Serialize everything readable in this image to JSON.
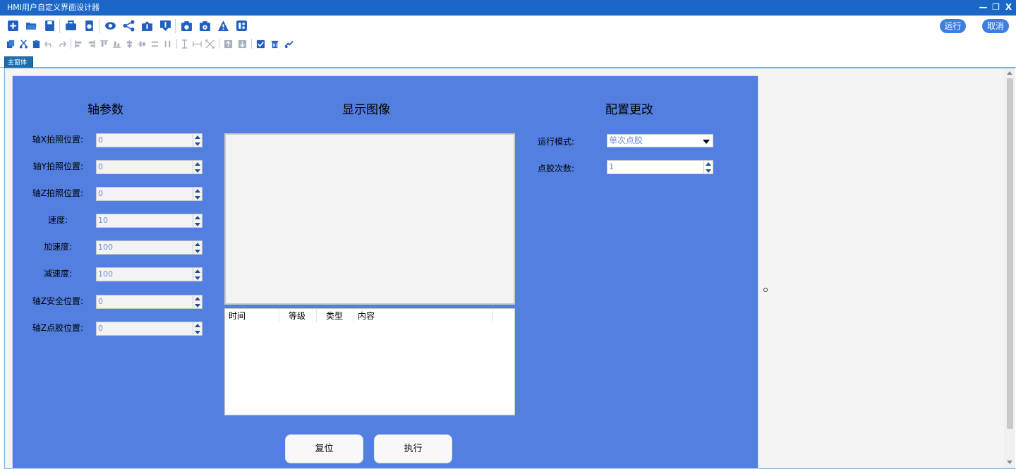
{
  "window": {
    "title": "HMI用户自定义界面设计器",
    "controls": [
      "—",
      "❐",
      "X"
    ]
  },
  "toolbar": {
    "primary_icons": [
      "new-icon",
      "open-folder-icon",
      "save-icon",
      "toolbox-icon",
      "export-icon",
      "preview-eye-icon",
      "share-icon",
      "upload-icon",
      "download-icon",
      "camera-icon",
      "camera-settings-icon",
      "warning-icon",
      "layout-icon"
    ],
    "edit_icons": [
      "copy-icon",
      "cut-icon",
      "paste-icon",
      "undo-icon",
      "redo-icon",
      "align-left-icon",
      "align-right-icon",
      "align-top-icon",
      "align-bottom-icon",
      "align-center-vertical-icon",
      "align-center-horizontal-icon",
      "distribute-horizontal-icon",
      "distribute-vertical-icon",
      "same-height-icon",
      "same-width-icon",
      "same-size-icon",
      "bring-front-icon",
      "send-back-icon",
      "select-all-icon",
      "delete-icon",
      "tool-icon"
    ],
    "run_label": "运行",
    "cancel_label": "取消"
  },
  "tabs": [
    {
      "label": "主窗体"
    }
  ],
  "form": {
    "axis_section_title": "轴参数",
    "image_section_title": "显示图像",
    "config_section_title": "配置更改",
    "axis_fields": [
      {
        "label": "轴X拍照位置:",
        "value": "0"
      },
      {
        "label": "轴Y拍照位置:",
        "value": "0"
      },
      {
        "label": "轴Z拍照位置:",
        "value": "0"
      },
      {
        "label": "速度:",
        "value": "10"
      },
      {
        "label": "加速度:",
        "value": "100"
      },
      {
        "label": "减速度:",
        "value": "100"
      },
      {
        "label": "轴Z安全位置:",
        "value": "0"
      },
      {
        "label": "轴Z点胶位置:",
        "value": "0"
      }
    ],
    "log_columns": [
      "时间",
      "等级",
      "类型",
      "内容"
    ],
    "run_mode_label": "运行模式:",
    "run_mode_value": "单次点胶",
    "dispense_count_label": "点胶次数:",
    "dispense_count_value": "1",
    "reset_label": "复位",
    "execute_label": "执行"
  },
  "colors": {
    "titlebar": "#1a67c8",
    "design_bg": "#527fe0",
    "accent": "#3d7fe0"
  }
}
